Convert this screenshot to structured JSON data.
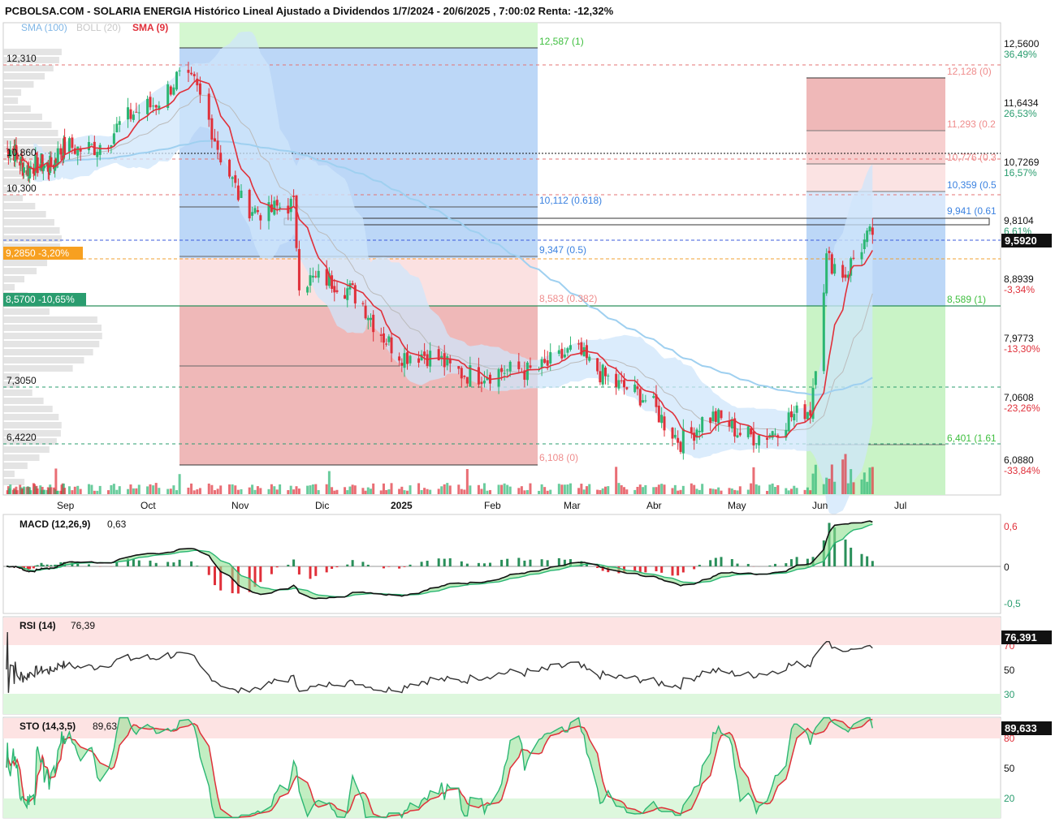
{
  "header": {
    "title": "PCBOLSA.COM - SOLARIA ENERGIA Histórico Lineal Ajustado a Dividendos 1/7/2024 - 20/6/2025 , 7:00:02 Renta: -12,32%"
  },
  "legend": {
    "sma100": "SMA (100)",
    "boll20": "BOLL (20)",
    "sma9": "SMA (9)"
  },
  "colors": {
    "up": "#2bb673",
    "down": "#e0303a",
    "sma9": "#e0303a",
    "sma100": "#9fd0f0",
    "boll": "#cfe6fb",
    "fib_blue": "#bcd7f7",
    "fib_red": "#f7caca",
    "fib_green": "#c9f3c6",
    "macd_line": "#111111",
    "signal_line": "#2bb673",
    "hist": "#2a8f5a"
  },
  "price_panel": {
    "right_axis": [
      {
        "price": "12,5600",
        "pct": "36,49%",
        "pct_color": "#2a9d6f"
      },
      {
        "price": "11,6434",
        "pct": "26,53%",
        "pct_color": "#2a9d6f"
      },
      {
        "price": "10,7269",
        "pct": "16,57%",
        "pct_color": "#2a9d6f"
      },
      {
        "price": "9,8104",
        "pct": "6,61%",
        "pct_color": "#2a9d6f"
      },
      {
        "price": "8,8939",
        "pct": "-3,34%",
        "pct_color": "#e0303a"
      },
      {
        "price": "7,9773",
        "pct": "-13,30%",
        "pct_color": "#e0303a"
      },
      {
        "price": "7,0608",
        "pct": "-23,26%",
        "pct_color": "#e0303a"
      },
      {
        "price": "6,0880",
        "pct": "-33,84%",
        "pct_color": "#e0303a"
      }
    ],
    "last_price_box": "9,5920",
    "left_levels": [
      {
        "label": "12,310",
        "style": "plain"
      },
      {
        "label": "10,860",
        "style": "plain"
      },
      {
        "label": "10,300",
        "style": "plain"
      },
      {
        "label": "9,2850 -3,20%",
        "style": "orange-box"
      },
      {
        "label": "8,5700 -10,65%",
        "style": "green-box"
      },
      {
        "label": "7,3050",
        "style": "plain"
      },
      {
        "label": "6,4220",
        "style": "plain"
      }
    ],
    "fib_left": [
      {
        "label": "12,587 (1)",
        "color": "#3fbf3f"
      },
      {
        "label": "10,112 (0.618)",
        "color": "#3b82e0"
      },
      {
        "label": "9,347 (0.5)",
        "color": "#3b82e0"
      },
      {
        "label": "8,583 (0.382)",
        "color": "#ef8c8c"
      },
      {
        "label": "6,108 (0)",
        "color": "#ef8c8c"
      }
    ],
    "fib_right": [
      {
        "label": "12,128 (0)",
        "color": "#ef8c8c"
      },
      {
        "label": "11,293 (0.2",
        "color": "#ef8c8c"
      },
      {
        "label": "10,776 (0.3",
        "color": "#ef8c8c"
      },
      {
        "label": "10,359 (0.5",
        "color": "#3b82e0"
      },
      {
        "label": "9,941 (0.61",
        "color": "#3b82e0"
      },
      {
        "label": "8,589 (1)",
        "color": "#3fbf3f"
      },
      {
        "label": "6,401 (1.61",
        "color": "#3fbf3f"
      }
    ],
    "x_axis": [
      "Sep",
      "Oct",
      "Nov",
      "Dic",
      "2025",
      "Feb",
      "Mar",
      "Abr",
      "May",
      "Jun",
      "Jul"
    ]
  },
  "macd_panel": {
    "label": "MACD (12,26,9)",
    "value": "0,63",
    "axis": [
      {
        "text": "0,6",
        "color": "#e0303a"
      },
      {
        "text": "0",
        "color": "#111111"
      },
      {
        "text": "-0,5",
        "color": "#2a9d6f"
      }
    ]
  },
  "rsi_panel": {
    "label": "RSI (14)",
    "value": "76,39",
    "last_box": "76,391",
    "axis": [
      {
        "text": "70",
        "color": "#e0303a"
      },
      {
        "text": "50",
        "color": "#111111"
      },
      {
        "text": "30",
        "color": "#2a9d6f"
      }
    ]
  },
  "sto_panel": {
    "label": "STO (14,3,5)",
    "value": "89,63",
    "last_box": "89,633",
    "axis": [
      {
        "text": "80",
        "color": "#e0303a"
      },
      {
        "text": "50",
        "color": "#111111"
      },
      {
        "text": "20",
        "color": "#2a9d6f"
      }
    ]
  },
  "chart_data": {
    "type": "candlestick",
    "title": "PCBOLSA.COM - SOLARIA ENERGIA Histórico Lineal Ajustado a Dividendos 1/7/2024 - 20/6/2025 , 7:00:02 Renta: -12,32%",
    "y_range": [
      5.5,
      13.0
    ],
    "series": [
      {
        "name": "SMA (100)"
      },
      {
        "name": "BOLL (20)"
      },
      {
        "name": "SMA (9)"
      }
    ],
    "close_points": [
      {
        "x": "2024-09-01",
        "y": 10.9
      },
      {
        "x": "2024-09-15",
        "y": 11.1
      },
      {
        "x": "2024-10-01",
        "y": 11.6
      },
      {
        "x": "2024-10-10",
        "y": 12.1
      },
      {
        "x": "2024-10-16",
        "y": 11.9
      },
      {
        "x": "2024-10-25",
        "y": 10.8
      },
      {
        "x": "2024-11-01",
        "y": 10.2
      },
      {
        "x": "2024-11-10",
        "y": 9.9
      },
      {
        "x": "2024-11-20",
        "y": 10.0
      },
      {
        "x": "2024-11-22",
        "y": 8.9
      },
      {
        "x": "2024-12-01",
        "y": 9.0
      },
      {
        "x": "2024-12-15",
        "y": 8.5
      },
      {
        "x": "2025-01-01",
        "y": 7.7
      },
      {
        "x": "2025-01-15",
        "y": 7.6
      },
      {
        "x": "2025-02-01",
        "y": 7.35
      },
      {
        "x": "2025-02-15",
        "y": 7.55
      },
      {
        "x": "2025-03-01",
        "y": 7.7
      },
      {
        "x": "2025-03-15",
        "y": 7.4
      },
      {
        "x": "2025-04-01",
        "y": 6.8
      },
      {
        "x": "2025-04-10",
        "y": 6.45
      },
      {
        "x": "2025-04-20",
        "y": 6.7
      },
      {
        "x": "2025-05-01",
        "y": 6.55
      },
      {
        "x": "2025-05-15",
        "y": 6.5
      },
      {
        "x": "2025-05-28",
        "y": 6.9
      },
      {
        "x": "2025-06-03",
        "y": 9.3
      },
      {
        "x": "2025-06-10",
        "y": 8.95
      },
      {
        "x": "2025-06-20",
        "y": 9.592
      }
    ],
    "rsi_last": 76.39,
    "sto_last": 89.63,
    "macd_last": 0.63
  }
}
